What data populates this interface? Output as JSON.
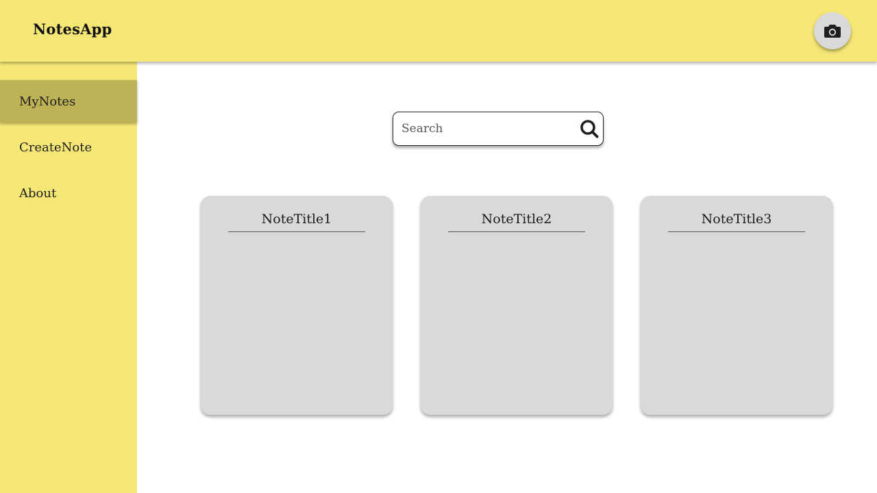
{
  "header": {
    "app_title": "NotesApp",
    "camera_icon": "camera-icon"
  },
  "sidebar": {
    "items": [
      {
        "label": "MyNotes",
        "active": true
      },
      {
        "label": "CreateNote",
        "active": false
      },
      {
        "label": "About",
        "active": false
      }
    ]
  },
  "search": {
    "placeholder": "Search",
    "value": "",
    "icon": "search-icon"
  },
  "notes": [
    {
      "title": "NoteTitle1",
      "body": ""
    },
    {
      "title": "NoteTitle2",
      "body": ""
    },
    {
      "title": "NoteTitle3",
      "body": ""
    }
  ],
  "colors": {
    "header_bg": "#f5e776",
    "sidebar_bg": "#f5e776",
    "sidebar_active_bg": "#bdb356",
    "card_bg": "#d9d9d9",
    "camera_button_bg": "#d9d9d9"
  }
}
